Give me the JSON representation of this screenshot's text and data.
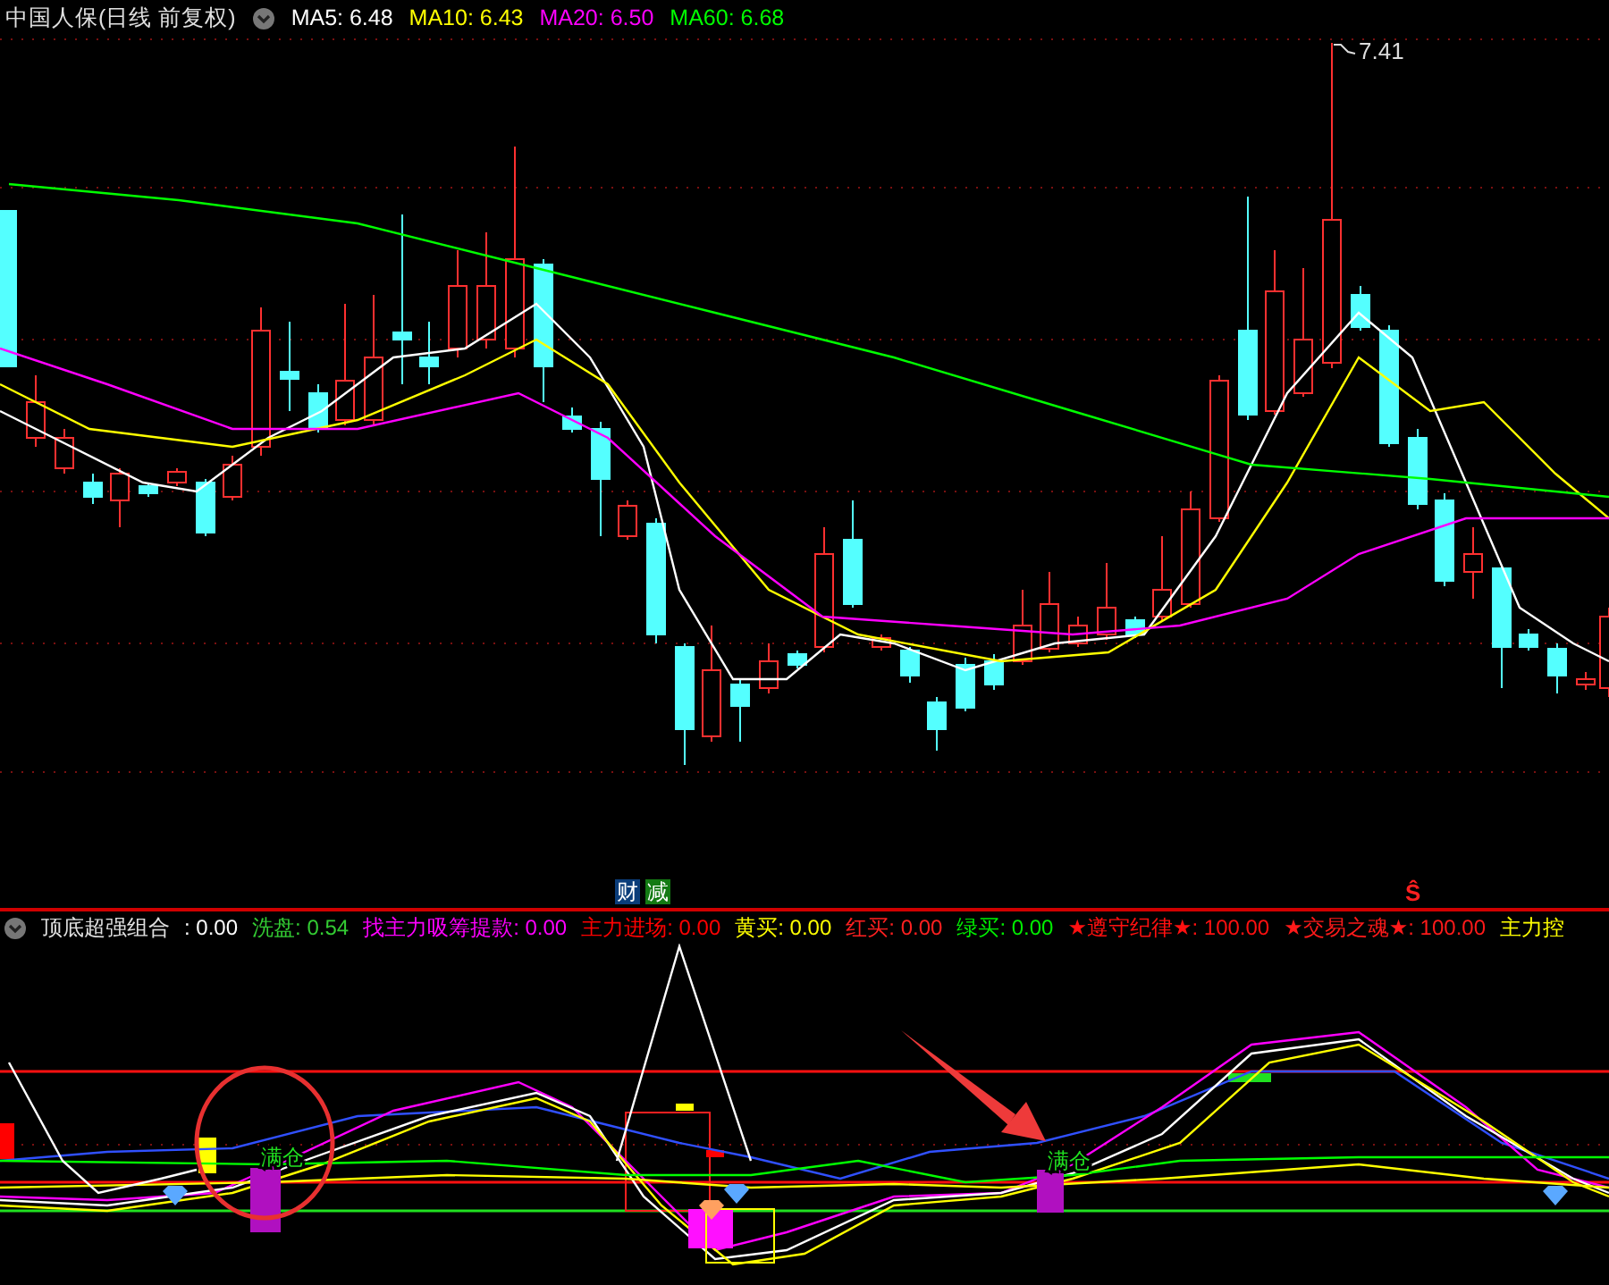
{
  "main_chart": {
    "title": "中国人保(日线 前复权)",
    "ma_readings": [
      {
        "text": "MA5: 6.48",
        "color": "#ffffff"
      },
      {
        "text": "MA10: 6.43",
        "color": "#ffff00"
      },
      {
        "text": "MA20: 6.50",
        "color": "#ff00ff"
      },
      {
        "text": "MA60: 6.68",
        "color": "#00ff00"
      }
    ],
    "high_label": "7.41",
    "event_badges": [
      {
        "text": "财",
        "color": "#0b3d7a"
      },
      {
        "text": "减",
        "color": "#137a13"
      }
    ],
    "signal_mark": "Ŝ"
  },
  "indicator": {
    "title": "顶底超强组合",
    "readings": [
      {
        "text": ": 0.00",
        "color": "#ffffff"
      },
      {
        "text": "洗盘: 0.54",
        "color": "#33cc33"
      },
      {
        "text": "找主力吸筹提款: 0.00",
        "color": "#ff00ff"
      },
      {
        "text": "主力进场: 0.00",
        "color": "#ff0000"
      },
      {
        "text": "黄买: 0.00",
        "color": "#ffff00"
      },
      {
        "text": "红买: 0.00",
        "color": "#ff2020"
      },
      {
        "text": "绿买: 0.00",
        "color": "#00ee00"
      },
      {
        "text": "★遵守纪律★: 100.00",
        "color": "#ff1010"
      },
      {
        "text": "★交易之魂★: 100.00",
        "color": "#ff1a1a"
      },
      {
        "text": "主力控",
        "color": "#ffff00"
      }
    ],
    "chart_labels": [
      "满仓",
      "满仓"
    ]
  }
}
